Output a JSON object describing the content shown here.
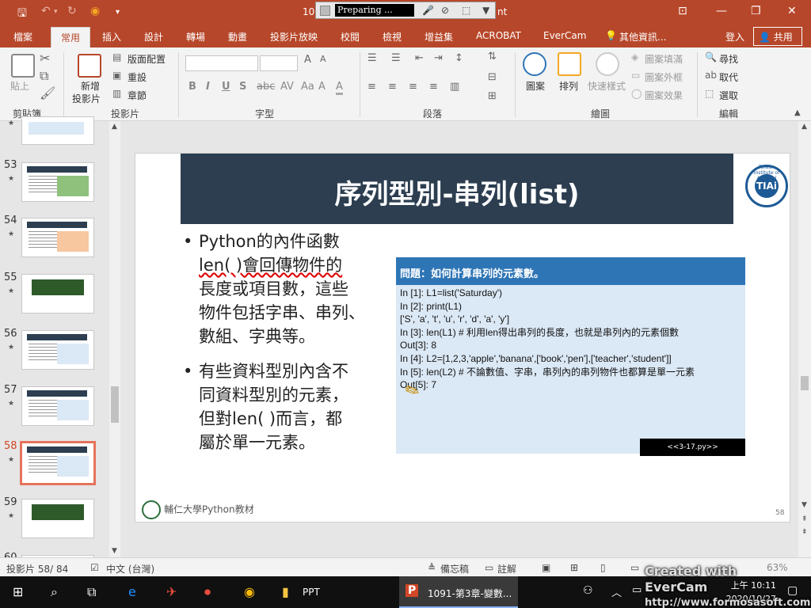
{
  "titlebar": {
    "title": "10",
    "title_suffix": "nt",
    "recorder_status": "Preparing ...",
    "quick_access": [
      "save-icon",
      "undo-icon",
      "redo-icon",
      "present-icon",
      "customize-icon"
    ]
  },
  "tabs": [
    "檔案",
    "常用",
    "插入",
    "設計",
    "轉場",
    "動畫",
    "投影片放映",
    "校閱",
    "檢視",
    "增益集",
    "ACROBAT",
    "EverCam",
    "其他資訊..."
  ],
  "active_tab": "常用",
  "account": {
    "signin": "登入",
    "share": "共用"
  },
  "ribbon": {
    "clipboard": {
      "label": "剪貼簿",
      "paste": "貼上"
    },
    "slides": {
      "label": "投影片",
      "new_slide": "新增",
      "new_slide2": "投影片",
      "layout": "版面配置",
      "reset": "重設",
      "section": "章節"
    },
    "font": {
      "label": "字型",
      "buttons": [
        "B",
        "I",
        "U",
        "S",
        "abc",
        "AV",
        "Aa",
        "A",
        "A"
      ]
    },
    "paragraph": {
      "label": "段落"
    },
    "drawing": {
      "label": "繪圖",
      "shapes": "圖案",
      "arrange": "排列",
      "quick_styles": "快速樣式",
      "fill": "圖案填滿",
      "outline": "圖案外框",
      "effects": "圖案效果"
    },
    "editing": {
      "label": "編輯",
      "find": "尋找",
      "replace": "取代",
      "select": "選取"
    }
  },
  "thumbnails": [
    {
      "num": "53",
      "kind": "table"
    },
    {
      "num": "54",
      "kind": "table"
    },
    {
      "num": "55",
      "kind": "green"
    },
    {
      "num": "56",
      "kind": "code"
    },
    {
      "num": "57",
      "kind": "code"
    },
    {
      "num": "58",
      "kind": "code",
      "selected": true
    },
    {
      "num": "59",
      "kind": "green"
    },
    {
      "num": "60",
      "kind": "partial"
    }
  ],
  "slide": {
    "title": "序列型別-串列(list)",
    "logo_ring": "Taiwan Institute of Artificial",
    "logo_text": "TIAi",
    "bullet1": [
      "Python的內件函數",
      "len( )會回傳物件的",
      "長度或項目數，這些",
      "物件包括字串、串列、",
      "數組、字典等。"
    ],
    "bullet2": [
      "有些資料型別內含不",
      "同資料型別的元素，",
      "但對len( )而言，都",
      "屬於單一元素。"
    ],
    "code_header": "問題：如何計算串列的元素數。",
    "code_lines": [
      "In [1]: L1=list('Saturday')",
      "In [2]: print(L1)",
      "['S', 'a', 't', 'u', 'r', 'd', 'a', 'y']",
      "In [3]: len(L1)  # 利用len得出串列的長度，也就是串列內的元素個數",
      "Out[3]: 8",
      "In [4]: L2=[1,2,3,'apple','banana',['book','pen'],['teacher','student']]",
      "In [5]: len(L2) # 不論數值、字串，串列內的串列物件也都算是單一元素",
      "Out[5]: 7"
    ],
    "file_label": "<<3-17.py>>",
    "footer": "輔仁大學Python教材",
    "page_number": "58"
  },
  "statusbar": {
    "slide_info": "投影片 58/ 84",
    "language": "中文 (台灣)",
    "notes": "備忘稿",
    "comments": "註解",
    "zoom": "63%"
  },
  "taskbar": {
    "ppt_folder": "PPT",
    "ppt_window": "1091-第3章-變數...",
    "time": "上午 10:11",
    "date": "2020/10/27"
  },
  "watermark": {
    "line1": "Created with EverCam",
    "line2": "http://www.formosasoft.com"
  },
  "colors": {
    "accent": "#b7472a",
    "slide_title_bg": "#2c3e50",
    "code_header": "#2e75b6",
    "code_bg": "#dbe8f5"
  }
}
